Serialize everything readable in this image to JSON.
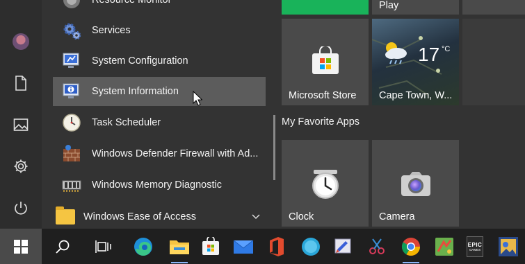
{
  "rail": {
    "items": [
      {
        "name": "user-avatar"
      },
      {
        "name": "documents-icon"
      },
      {
        "name": "pictures-icon"
      },
      {
        "name": "settings-icon"
      },
      {
        "name": "power-icon"
      }
    ]
  },
  "apps": {
    "partial_top": "Resource Monitor",
    "items": [
      {
        "label": "Services",
        "icon": "services-gear-icon"
      },
      {
        "label": "System Configuration",
        "icon": "system-configuration-icon"
      },
      {
        "label": "System Information",
        "icon": "system-information-icon",
        "selected": true
      },
      {
        "label": "Task Scheduler",
        "icon": "task-scheduler-clock-icon"
      },
      {
        "label": "Windows Defender Firewall with Ad...",
        "icon": "firewall-icon"
      },
      {
        "label": "Windows Memory Diagnostic",
        "icon": "memory-chip-icon"
      }
    ],
    "folder": {
      "label": "Windows Ease of Access",
      "icon": "folder-icon"
    }
  },
  "tiles": {
    "play": {
      "label": "Play"
    },
    "store": {
      "label": "Microsoft Store"
    },
    "weather": {
      "label": "Cape Town, W...",
      "temp": "17",
      "unit": "°C"
    },
    "group_title": "My Favorite Apps",
    "clock": {
      "label": "Clock"
    },
    "camera": {
      "label": "Camera"
    }
  },
  "taskbar": {
    "items": [
      "search-icon",
      "task-view-icon",
      "edge-icon",
      "file-explorer-icon",
      "store-icon",
      "mail-icon",
      "office-icon",
      "cortana-icon",
      "paint-icon",
      "snipping-tool-icon",
      "chrome-icon",
      "game-icon",
      "epic-games-icon",
      "photos-icon"
    ],
    "epic_text": "EPIC",
    "epic_sub": "GAMES"
  },
  "colors": {
    "green_tile": "#19b35a",
    "selected_row": "#5c5c5c",
    "tile_bg": "#4a4a4a",
    "weather_bg": "#2a3a4a"
  }
}
